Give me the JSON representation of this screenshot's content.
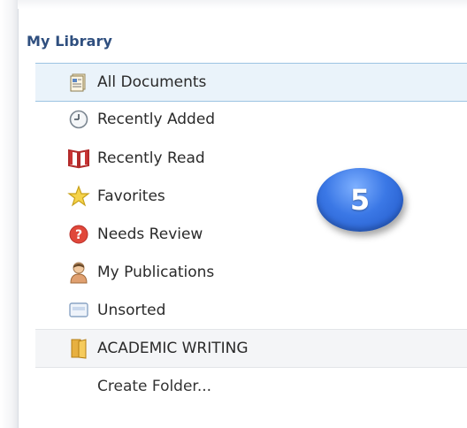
{
  "library": {
    "title": "My Library",
    "items": [
      {
        "label": "All Documents",
        "icon": "documents-icon"
      },
      {
        "label": "Recently Added",
        "icon": "clock-icon"
      },
      {
        "label": "Recently Read",
        "icon": "book-icon"
      },
      {
        "label": "Favorites",
        "icon": "star-icon"
      },
      {
        "label": "Needs Review",
        "icon": "question-icon"
      },
      {
        "label": "My Publications",
        "icon": "person-icon"
      },
      {
        "label": "Unsorted",
        "icon": "tray-icon"
      }
    ],
    "folder": {
      "label": "ACADEMIC WRITING",
      "icon": "folder-icon"
    },
    "create_folder": "Create Folder..."
  },
  "callout": {
    "number": "5"
  },
  "colors": {
    "title": "#2f4f7f",
    "selected_bg": "#eaf3fa",
    "selected_border": "#9cc3e2",
    "badge": "#3b78e6"
  }
}
